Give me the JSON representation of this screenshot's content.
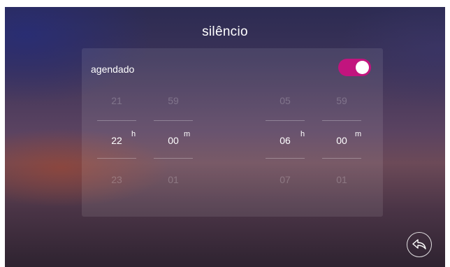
{
  "title": "silêncio",
  "schedule": {
    "label": "agendado",
    "toggle_on": true,
    "toggle_color": "#c2147e"
  },
  "start_time": {
    "hour": {
      "prev": "21",
      "value": "22",
      "next": "23",
      "unit": "h"
    },
    "minute": {
      "prev": "59",
      "value": "00",
      "next": "01",
      "unit": "m"
    }
  },
  "end_time": {
    "hour": {
      "prev": "05",
      "value": "06",
      "next": "07",
      "unit": "h"
    },
    "minute": {
      "prev": "59",
      "value": "00",
      "next": "01",
      "unit": "m"
    }
  },
  "back_button": {
    "icon": "back-arrow-icon"
  }
}
